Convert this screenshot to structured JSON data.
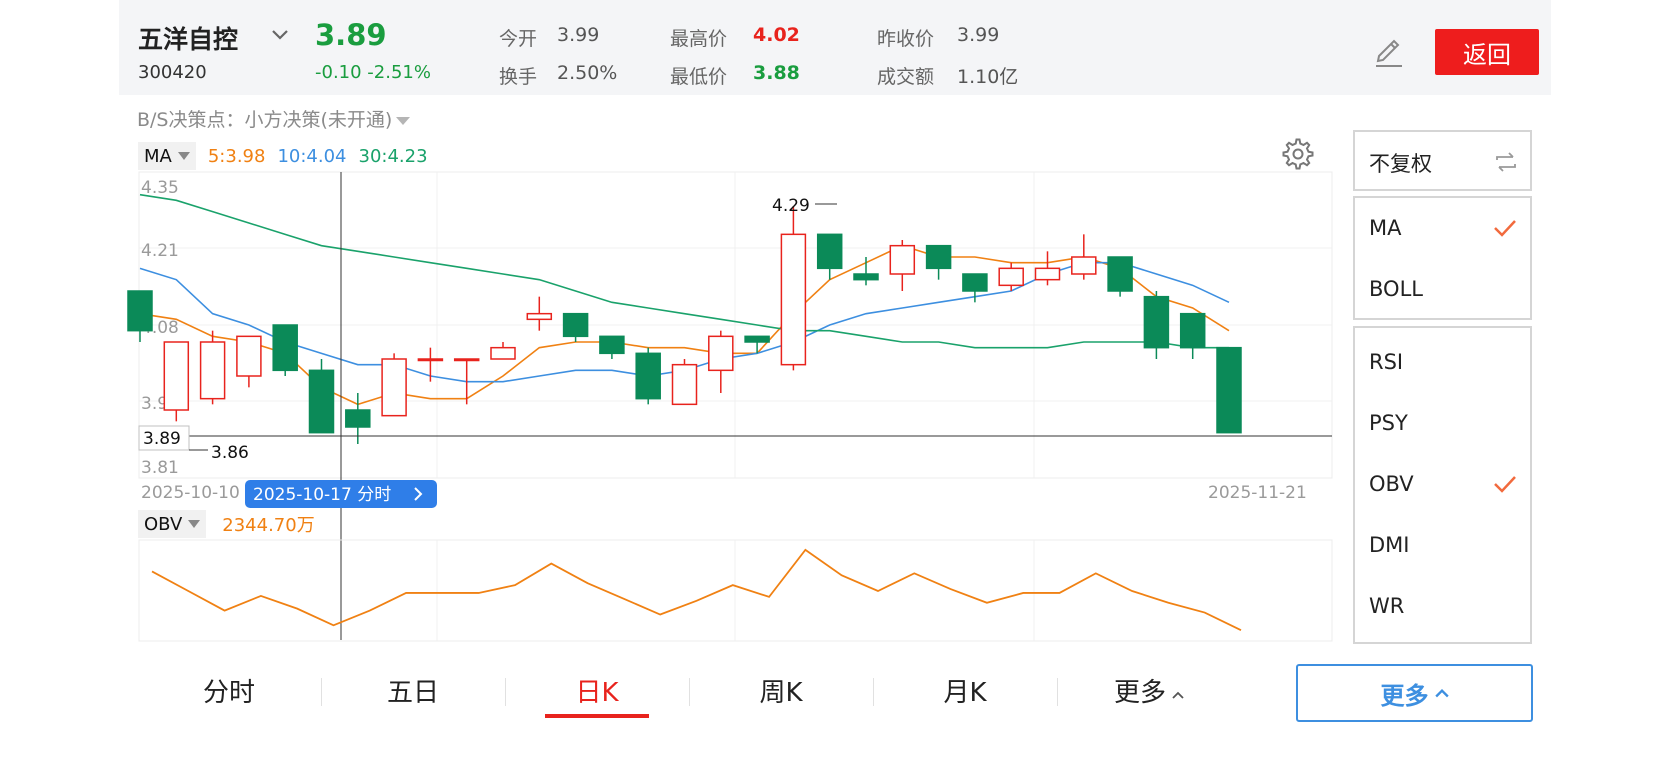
{
  "header": {
    "name": "五洋自控",
    "code": "300420",
    "price": "3.89",
    "change": "-0.10 -2.51%",
    "stats": {
      "open_label": "今开",
      "open": "3.99",
      "high_label": "最高价",
      "high": "4.02",
      "prev_label": "昨收价",
      "prev": "3.99",
      "turnover_label": "换手",
      "turnover": "2.50%",
      "low_label": "最低价",
      "low": "3.88",
      "amount_label": "成交额",
      "amount": "1.10亿"
    },
    "back_label": "返回",
    "icons": [
      "chevron-down-icon",
      "edit-icon"
    ]
  },
  "bs_decision": "B/S决策点：小方决策(未开通)",
  "indicator": {
    "name": "MA",
    "ma5": "5:3.98",
    "ma10": "10:4.04",
    "ma30": "30:4.23"
  },
  "price_axis": {
    "labels": [
      "4.35",
      "4.21",
      "4.08",
      "3.95",
      "3.81"
    ],
    "current_tag": "3.89",
    "min_label": "3.86",
    "max_label": "4.29"
  },
  "dates": {
    "start": "2025-10-10",
    "crosshair": "2025-10-17 分时",
    "end": "2025-11-21"
  },
  "sub_indicator": {
    "name": "OBV",
    "value": "2344.70万"
  },
  "side_panel": {
    "adjust": "不复权",
    "main": [
      {
        "label": "MA",
        "checked": true
      },
      {
        "label": "BOLL",
        "checked": false
      }
    ],
    "sub": [
      {
        "label": "RSI",
        "checked": false
      },
      {
        "label": "PSY",
        "checked": false
      },
      {
        "label": "OBV",
        "checked": true
      },
      {
        "label": "DMI",
        "checked": false
      },
      {
        "label": "WR",
        "checked": false
      }
    ]
  },
  "tabs": [
    "分时",
    "五日",
    "日K",
    "周K",
    "月K",
    "更多"
  ],
  "active_tab": "日K",
  "more_button": "更多",
  "colors": {
    "up": "#e8231d",
    "down": "#0b8a58",
    "ma5": "#f08113",
    "ma10": "#3d8fe0",
    "ma30": "#1aa26b",
    "obv": "#f08113",
    "accent": "#3d8fe0"
  },
  "chart_data": {
    "type": "candlestick",
    "x_range": [
      "2025-10-10",
      "2025-11-21"
    ],
    "ylim": [
      3.81,
      4.35
    ],
    "candles": [
      {
        "open": 4.14,
        "close": 4.07,
        "high": 4.14,
        "low": 4.05
      },
      {
        "open": 3.93,
        "close": 4.05,
        "high": 4.05,
        "low": 3.91
      },
      {
        "open": 3.95,
        "close": 4.05,
        "high": 4.07,
        "low": 3.94
      },
      {
        "open": 3.99,
        "close": 4.06,
        "high": 4.06,
        "low": 3.97
      },
      {
        "open": 4.08,
        "close": 4.0,
        "high": 4.08,
        "low": 3.99
      },
      {
        "open": 4.0,
        "close": 3.89,
        "high": 4.02,
        "low": 3.89
      },
      {
        "open": 3.93,
        "close": 3.9,
        "high": 3.96,
        "low": 3.87
      },
      {
        "open": 3.92,
        "close": 4.02,
        "high": 4.03,
        "low": 3.92
      },
      {
        "open": 4.02,
        "close": 4.02,
        "high": 4.04,
        "low": 3.98
      },
      {
        "open": 4.02,
        "close": 4.02,
        "high": 4.02,
        "low": 3.94
      },
      {
        "open": 4.02,
        "close": 4.04,
        "high": 4.05,
        "low": 4.02
      },
      {
        "open": 4.09,
        "close": 4.1,
        "high": 4.13,
        "low": 4.07
      },
      {
        "open": 4.1,
        "close": 4.06,
        "high": 4.1,
        "low": 4.05
      },
      {
        "open": 4.06,
        "close": 4.03,
        "high": 4.06,
        "low": 4.02
      },
      {
        "open": 4.03,
        "close": 3.95,
        "high": 4.04,
        "low": 3.94
      },
      {
        "open": 3.94,
        "close": 4.01,
        "high": 4.02,
        "low": 3.94
      },
      {
        "open": 4.0,
        "close": 4.06,
        "high": 4.07,
        "low": 3.96
      },
      {
        "open": 4.06,
        "close": 4.05,
        "high": 4.06,
        "low": 4.03
      },
      {
        "open": 4.01,
        "close": 4.24,
        "high": 4.29,
        "low": 4.0
      },
      {
        "open": 4.24,
        "close": 4.18,
        "high": 4.24,
        "low": 4.16
      },
      {
        "open": 4.17,
        "close": 4.16,
        "high": 4.2,
        "low": 4.15
      },
      {
        "open": 4.17,
        "close": 4.22,
        "high": 4.23,
        "low": 4.14
      },
      {
        "open": 4.22,
        "close": 4.18,
        "high": 4.22,
        "low": 4.16
      },
      {
        "open": 4.17,
        "close": 4.14,
        "high": 4.17,
        "low": 4.12
      },
      {
        "open": 4.15,
        "close": 4.18,
        "high": 4.19,
        "low": 4.14
      },
      {
        "open": 4.16,
        "close": 4.18,
        "high": 4.21,
        "low": 4.15
      },
      {
        "open": 4.17,
        "close": 4.2,
        "high": 4.24,
        "low": 4.16
      },
      {
        "open": 4.2,
        "close": 4.14,
        "high": 4.2,
        "low": 4.13
      },
      {
        "open": 4.13,
        "close": 4.04,
        "high": 4.14,
        "low": 4.02
      },
      {
        "open": 4.1,
        "close": 4.04,
        "high": 4.1,
        "low": 4.02
      },
      {
        "open": 4.04,
        "close": 3.89,
        "high": 4.04,
        "low": 3.89
      }
    ],
    "series": [
      {
        "name": "5",
        "values": [
          4.1,
          4.09,
          4.06,
          4.05,
          4.03,
          3.97,
          3.94,
          3.96,
          3.95,
          3.95,
          3.99,
          4.04,
          4.05,
          4.05,
          4.04,
          4.04,
          4.03,
          4.03,
          4.1,
          4.16,
          4.19,
          4.22,
          4.2,
          4.2,
          4.19,
          4.19,
          4.2,
          4.18,
          4.13,
          4.11,
          4.07
        ]
      },
      {
        "name": "10",
        "values": [
          4.18,
          4.16,
          4.1,
          4.08,
          4.05,
          4.03,
          4.01,
          4.01,
          3.99,
          3.98,
          3.98,
          3.99,
          4.0,
          4.0,
          3.99,
          4.0,
          4.02,
          4.03,
          4.05,
          4.08,
          4.1,
          4.11,
          4.12,
          4.13,
          4.14,
          4.17,
          4.19,
          4.19,
          4.17,
          4.15,
          4.12
        ]
      },
      {
        "name": "30",
        "values": [
          4.31,
          4.3,
          4.28,
          4.26,
          4.24,
          4.22,
          4.21,
          4.2,
          4.19,
          4.18,
          4.17,
          4.16,
          4.14,
          4.12,
          4.11,
          4.1,
          4.09,
          4.08,
          4.07,
          4.07,
          4.06,
          4.05,
          4.05,
          4.04,
          4.04,
          4.04,
          4.05,
          4.05,
          4.05,
          4.04,
          4.04
        ]
      },
      {
        "name": "OBV",
        "values": [
          70,
          50,
          30,
          45,
          32,
          15,
          30,
          48,
          48,
          48,
          56,
          78,
          58,
          42,
          26,
          40,
          56,
          44,
          92,
          66,
          50,
          68,
          52,
          38,
          48,
          48,
          68,
          50,
          38,
          28,
          10
        ]
      }
    ]
  }
}
